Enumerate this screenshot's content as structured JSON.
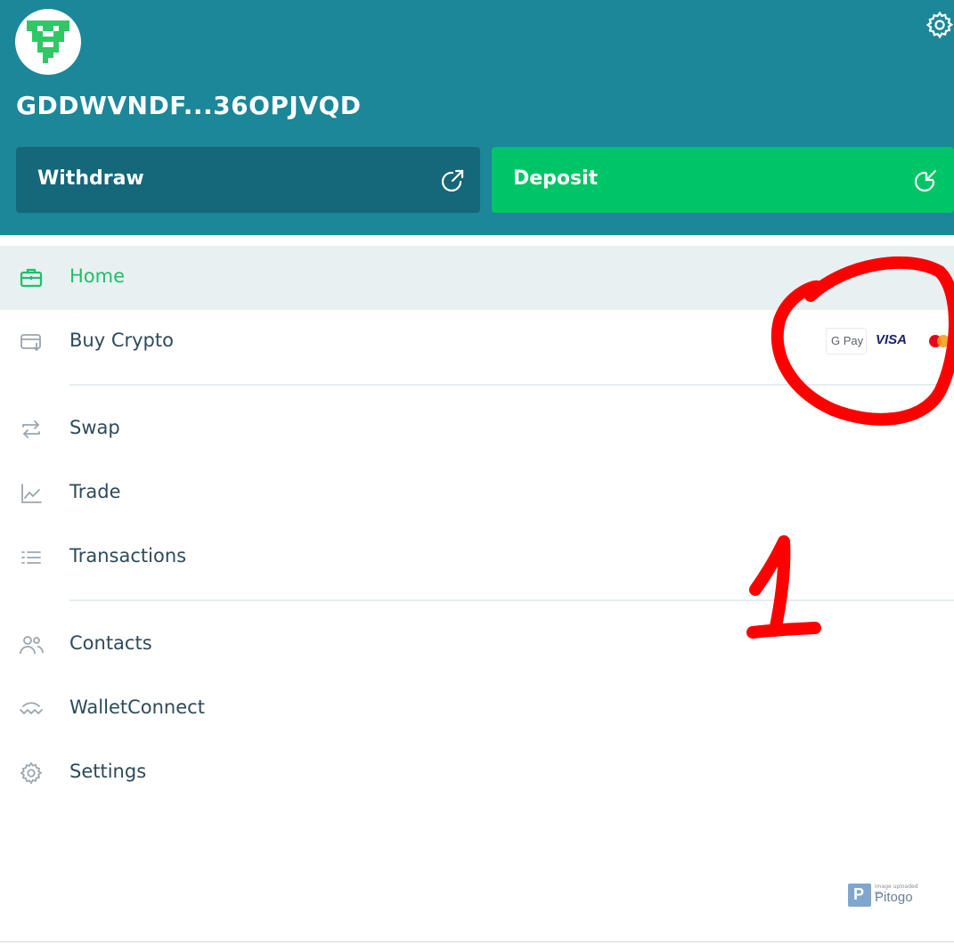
{
  "header": {
    "avatar_icon": "identicon-avatar",
    "address": "GDDWVNDF...36OPJVQD",
    "settings_icon": "gear-icon",
    "withdraw_label": "Withdraw",
    "withdraw_icon": "arrow-up-right-icon",
    "deposit_label": "Deposit",
    "deposit_icon": "arrow-down-left-icon"
  },
  "nav": {
    "items": [
      {
        "label": "Home",
        "icon": "briefcase-icon",
        "active": true
      },
      {
        "label": "Buy Crypto",
        "icon": "card-download-icon"
      },
      {
        "label": "Swap",
        "icon": "swap-arrows-icon"
      },
      {
        "label": "Trade",
        "icon": "chart-line-icon"
      },
      {
        "label": "Transactions",
        "icon": "list-icon"
      },
      {
        "label": "Contacts",
        "icon": "people-icon"
      },
      {
        "label": "WalletConnect",
        "icon": "walletconnect-icon"
      },
      {
        "label": "Settings",
        "icon": "gear-icon"
      }
    ]
  },
  "payments": {
    "gpay": "G Pay",
    "visa": "VISA",
    "mastercard_icon": "mastercard-icon"
  },
  "annotation": {
    "number": "1"
  },
  "watermark": {
    "small": "image uploaded on",
    "name": "Pitogo"
  },
  "colors": {
    "header_bg": "#1b8799",
    "withdraw_bg": "#15677a",
    "deposit_bg": "#00c566",
    "active_bg": "#e8f0f2",
    "active_text": "#1fbf6a",
    "annotation_red": "#ff0000"
  }
}
